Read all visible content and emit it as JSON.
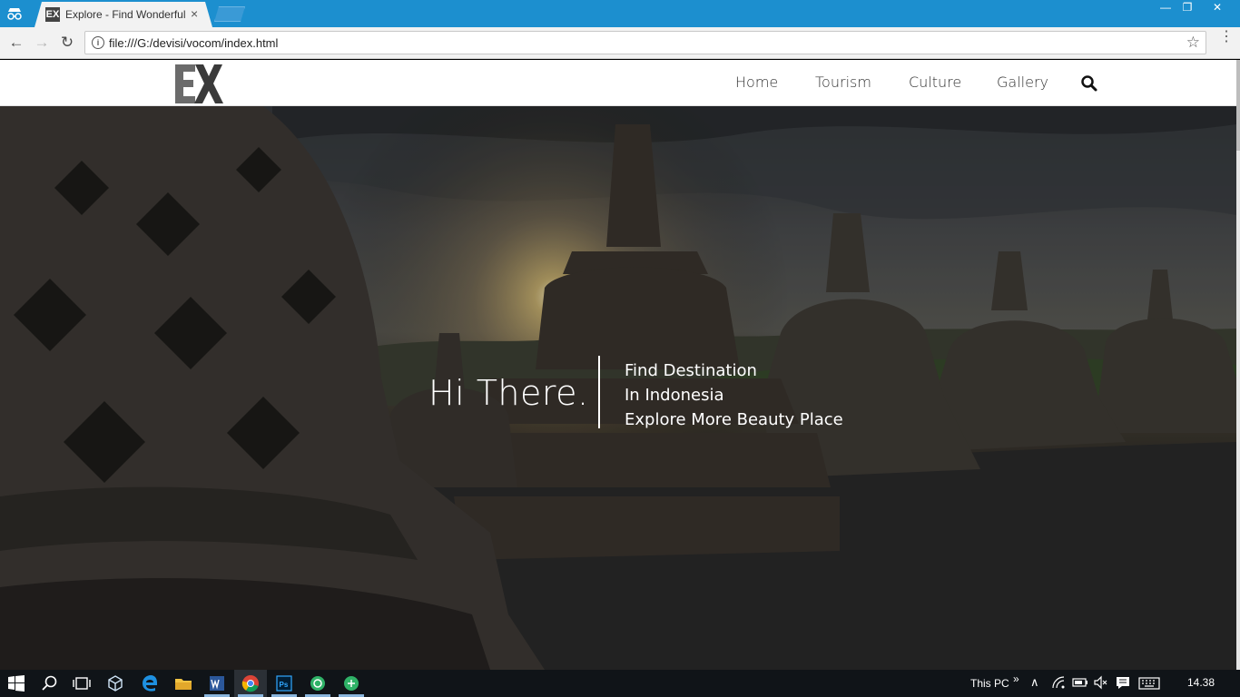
{
  "browser": {
    "tab_title": "Explore - Find Wonderful",
    "tab_favicon": "EX",
    "tab_close": "×",
    "url": "file:///G:/devisi/vocom/index.html",
    "window_controls": {
      "minimize": "—",
      "maximize": "❐",
      "close": "✕"
    },
    "nav": {
      "back": "←",
      "forward": "→",
      "reload": "↻"
    },
    "info_icon": "i",
    "star_icon": "☆",
    "menu_icon": "⋮"
  },
  "site": {
    "logo_text": "EX",
    "nav_items": [
      "Home",
      "Tourism",
      "Culture",
      "Gallery"
    ],
    "search_icon": "search-icon"
  },
  "hero": {
    "greeting": "Hi There.",
    "lines": [
      "Find Destination",
      "In Indonesia",
      "Explore More Beauty Place"
    ]
  },
  "taskbar": {
    "this_pc": "This PC",
    "chevron": "»",
    "tray_up": "∧",
    "clock": "14.38",
    "apps": [
      "start-icon",
      "search-icon",
      "task-view-icon",
      "3d-box-icon",
      "edge-icon",
      "file-explorer-icon",
      "word-icon",
      "chrome-icon",
      "photoshop-icon",
      "app-green-icon",
      "app-green-2-icon"
    ]
  },
  "colors": {
    "titlebar": "#1c8fcf",
    "toolbar": "#f2f2f2",
    "taskbar": "#101418",
    "logo_gray": "#6b6b6b",
    "logo_dark": "#3a3a3a"
  }
}
